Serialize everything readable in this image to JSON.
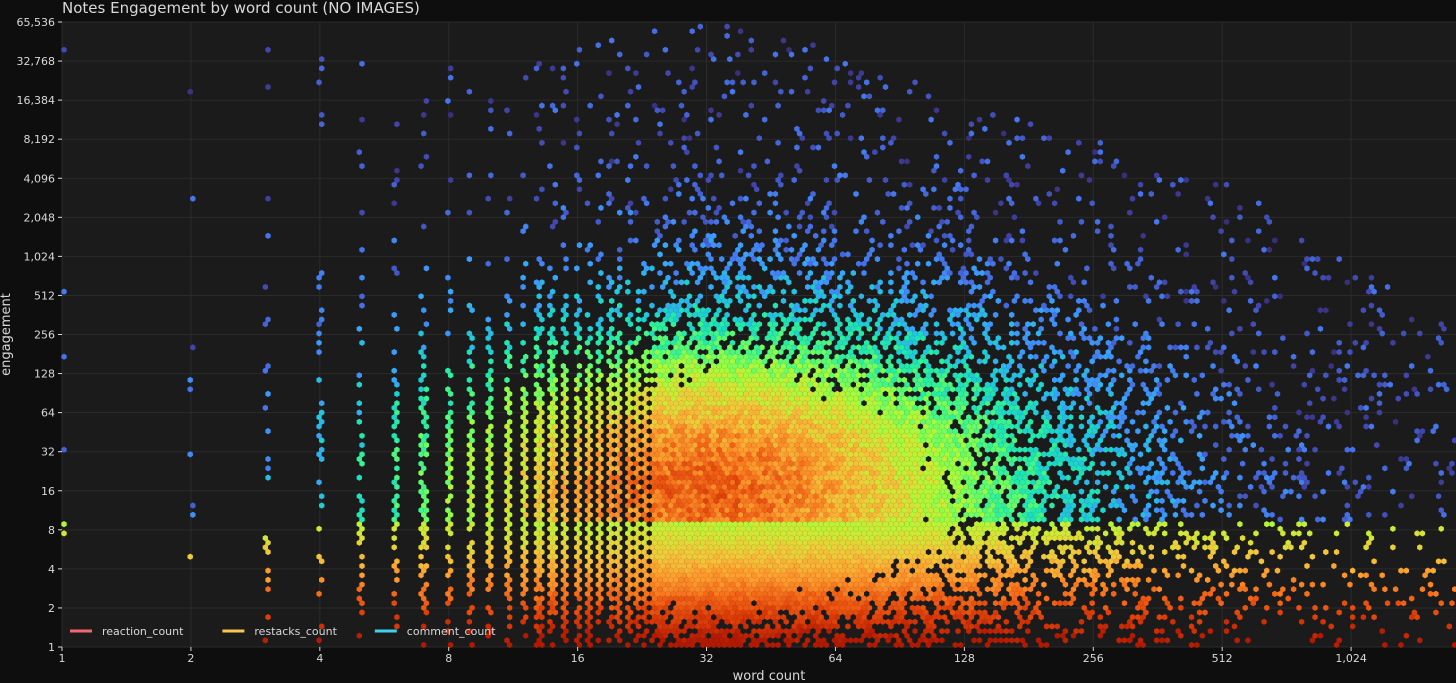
{
  "chart_data": {
    "type": "heatmap",
    "subtype": "hexbin",
    "title": "Notes Engagement by word count (NO IMAGES)",
    "xlabel": "word count",
    "ylabel": "engagement",
    "x_scale": "log2",
    "y_scale": "log2",
    "xlim": [
      1,
      1800
    ],
    "ylim": [
      1,
      65536
    ],
    "x_ticks": [
      {
        "value": 1,
        "label": "1"
      },
      {
        "value": 2,
        "label": "2"
      },
      {
        "value": 4,
        "label": "4"
      },
      {
        "value": 8,
        "label": "8"
      },
      {
        "value": 16,
        "label": "16"
      },
      {
        "value": 32,
        "label": "32"
      },
      {
        "value": 64,
        "label": "64"
      },
      {
        "value": 128,
        "label": "128"
      },
      {
        "value": 256,
        "label": "256"
      },
      {
        "value": 512,
        "label": "512"
      },
      {
        "value": 1024,
        "label": "1,024"
      }
    ],
    "y_ticks": [
      {
        "value": 1,
        "label": "1"
      },
      {
        "value": 2,
        "label": "2"
      },
      {
        "value": 4,
        "label": "4"
      },
      {
        "value": 8,
        "label": "8"
      },
      {
        "value": 16,
        "label": "16"
      },
      {
        "value": 32,
        "label": "32"
      },
      {
        "value": 64,
        "label": "64"
      },
      {
        "value": 128,
        "label": "128"
      },
      {
        "value": 256,
        "label": "256"
      },
      {
        "value": 512,
        "label": "512"
      },
      {
        "value": 1024,
        "label": "1,024"
      },
      {
        "value": 2048,
        "label": "2,048"
      },
      {
        "value": 4096,
        "label": "4,096"
      },
      {
        "value": 8192,
        "label": "8,192"
      },
      {
        "value": 16384,
        "label": "16,384"
      },
      {
        "value": 32768,
        "label": "32,768"
      },
      {
        "value": 65536,
        "label": "65,536"
      }
    ],
    "grid": true,
    "legend": {
      "placement": "bottom-left",
      "entries": [
        {
          "name": "reaction_count",
          "color": "#f0696f"
        },
        {
          "name": "restacks_count",
          "color": "#f5c451"
        },
        {
          "name": "comment_count",
          "color": "#3ed0f0"
        }
      ]
    },
    "colors": {
      "background": "#0e0e0e",
      "plot_background": "#1b1b1b",
      "grid": "#2b2b2b",
      "text": "#d8d8d8",
      "colormap": [
        "#30123b",
        "#4145ab",
        "#4675ed",
        "#39a2fc",
        "#1bcfd4",
        "#24eca6",
        "#61fc6c",
        "#a4fc3b",
        "#d1e834",
        "#f3c63a",
        "#fe9b2d",
        "#f36315",
        "#d93806",
        "#b11901"
      ]
    },
    "series": [
      {
        "name": "reaction_count"
      },
      {
        "name": "restacks_count"
      },
      {
        "name": "comment_count"
      }
    ],
    "density_model": {
      "description_free": true,
      "discrete_word_counts_until": 24,
      "density_peak_word_count": 32,
      "density_peak_engagement": 16,
      "upper_envelope": [
        [
          1,
          60000
        ],
        [
          8,
          30000
        ],
        [
          16,
          50000
        ],
        [
          32,
          65536
        ],
        [
          64,
          40000
        ],
        [
          128,
          16000
        ],
        [
          256,
          8000
        ],
        [
          512,
          4096
        ],
        [
          1024,
          1024
        ],
        [
          1800,
          256
        ]
      ],
      "dense_core_envelope": [
        [
          1,
          20000
        ],
        [
          16,
          16384
        ],
        [
          32,
          16384
        ],
        [
          64,
          6000
        ],
        [
          128,
          1500
        ],
        [
          256,
          400
        ],
        [
          512,
          128
        ],
        [
          1024,
          32
        ],
        [
          1800,
          16
        ]
      ]
    }
  }
}
